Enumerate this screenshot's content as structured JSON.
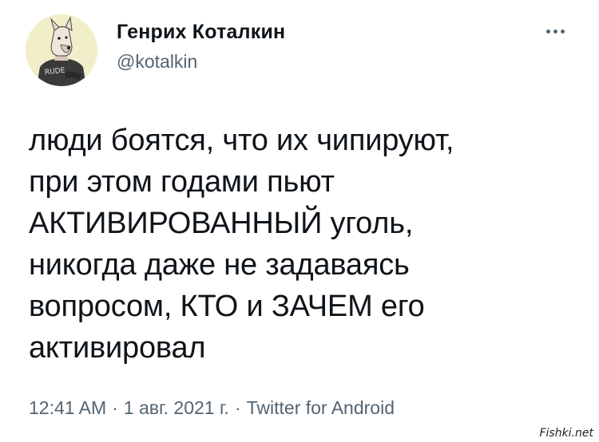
{
  "tweet": {
    "author": {
      "display_name": "Генрих Коталкин",
      "handle": "@kotalkin",
      "avatar_icon": "dog-avatar-icon",
      "avatar_shirt_text": "RUDE"
    },
    "more_icon": "more-dots-icon",
    "text_lines": [
      "люди боятся, что их чипируют,",
      "при этом годами пьют",
      "АКТИВИРОВАННЫЙ уголь,",
      "никогда даже не задаваясь",
      "вопросом, КТО и ЗАЧЕМ его",
      "активировал"
    ],
    "time": "12:41 AM",
    "separator": "·",
    "date": "1 авг. 2021 г.",
    "source": "Twitter for Android"
  },
  "watermark": "Fishki.net",
  "colors": {
    "text": "#0f1419",
    "secondary": "#536471",
    "avatar_bg": "#f1efc9"
  }
}
